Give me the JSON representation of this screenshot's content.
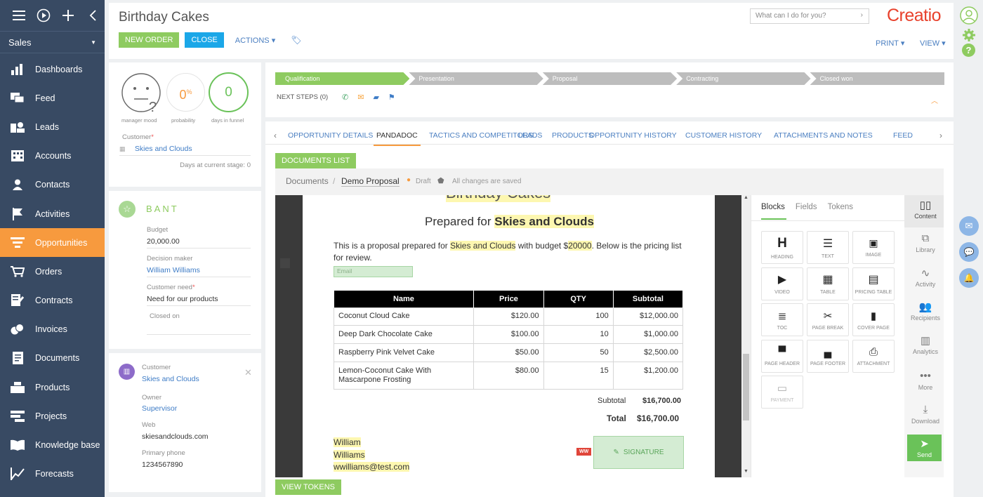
{
  "app": {
    "workspace": "Sales",
    "brand": "Creatio"
  },
  "sidebar": {
    "items": [
      {
        "label": "Dashboards",
        "icon": "bar-chart-icon"
      },
      {
        "label": "Feed",
        "icon": "chat-bubbles-icon"
      },
      {
        "label": "Leads",
        "icon": "leads-icon"
      },
      {
        "label": "Accounts",
        "icon": "building-icon"
      },
      {
        "label": "Contacts",
        "icon": "person-icon"
      },
      {
        "label": "Activities",
        "icon": "flag-icon"
      },
      {
        "label": "Opportunities",
        "icon": "funnel-icon"
      },
      {
        "label": "Orders",
        "icon": "cart-icon"
      },
      {
        "label": "Contracts",
        "icon": "contract-icon"
      },
      {
        "label": "Invoices",
        "icon": "invoice-icon"
      },
      {
        "label": "Documents",
        "icon": "document-icon"
      },
      {
        "label": "Products",
        "icon": "products-icon"
      },
      {
        "label": "Projects",
        "icon": "projects-icon"
      },
      {
        "label": "Knowledge base",
        "icon": "book-icon"
      },
      {
        "label": "Forecasts",
        "icon": "forecast-icon"
      }
    ]
  },
  "header": {
    "title": "Birthday Cakes",
    "new_order": "NEW ORDER",
    "close": "CLOSE",
    "actions": "ACTIONS",
    "print": "PRINT",
    "view": "VIEW",
    "search_placeholder": "What can I do for you?"
  },
  "summary": {
    "mood_label": "manager mood",
    "probability": "0",
    "probability_unit": "%",
    "probability_label": "probability",
    "days": "0",
    "days_label": "days in funnel",
    "customer_label": "Customer",
    "customer_value": "Skies and Clouds",
    "days_stage": "Days at current stage: 0"
  },
  "bant": {
    "title": "BANT",
    "budget_label": "Budget",
    "budget_value": "20,000.00",
    "decision_label": "Decision maker",
    "decision_value": "William Williams",
    "need_label": "Customer need",
    "need_value": "Need for our products",
    "closed_label": "Closed on"
  },
  "customer_card": {
    "customer_label": "Customer",
    "customer_value": "Skies and Clouds",
    "owner_label": "Owner",
    "owner_value": "Supervisor",
    "web_label": "Web",
    "web_value": "skiesandclouds.com",
    "phone_label": "Primary phone",
    "phone_value": "1234567890"
  },
  "stages": [
    "Qualification",
    "Presentation",
    "Proposal",
    "Contracting",
    "Closed won"
  ],
  "next_steps": "NEXT STEPS (0)",
  "tabs": [
    "OPPORTUNITY DETAILS",
    "PANDADOC",
    "TACTICS AND COMPETITORS",
    "LEADS",
    "PRODUCTS",
    "OPPORTUNITY HISTORY",
    "CUSTOMER HISTORY",
    "ATTACHMENTS AND NOTES",
    "FEED"
  ],
  "pandadoc": {
    "documents_list": "DOCUMENTS LIST",
    "breadcrumb_root": "Documents",
    "doc_name": "Demo Proposal",
    "status": "Draft",
    "saved": "All changes are saved",
    "view_tokens": "VIEW TOKENS"
  },
  "document": {
    "title_cut": "Birthday Cakes",
    "prepared_prefix": "Prepared for ",
    "prepared_name": "Skies and Clouds",
    "intro_1": "This is a proposal prepared for ",
    "intro_name": "Skies and Clouds",
    "intro_2": " with budget $",
    "intro_budget": "20000",
    "intro_3": ". Below is the pricing list",
    "intro_4": "for review.",
    "email_placeholder": "Email",
    "table": {
      "headers": [
        "Name",
        "Price",
        "QTY",
        "Subtotal"
      ],
      "rows": [
        [
          "Coconut Cloud Cake",
          "$120.00",
          "100",
          "$12,000.00"
        ],
        [
          "Deep Dark Chocolate Cake",
          "$100.00",
          "10",
          "$1,000.00"
        ],
        [
          "Raspberry Pink Velvet Cake",
          "$50.00",
          "50",
          "$2,500.00"
        ],
        [
          "Lemon-Coconut Cake With Mascarpone Frosting",
          "$80.00",
          "15",
          "$1,200.00"
        ]
      ]
    },
    "subtotal_label": "Subtotal",
    "subtotal_value": "$16,700.00",
    "total_label": "Total",
    "total_value": "$16,700.00",
    "sig_first": "William",
    "sig_last": "Williams",
    "sig_email": "wwilliams@test.com",
    "sig_tag": "WW",
    "signature": "SIGNATURE"
  },
  "editor": {
    "tabs": [
      "Blocks",
      "Fields",
      "Tokens"
    ],
    "blocks": [
      "HEADING",
      "TEXT",
      "IMAGE",
      "VIDEO",
      "TABLE",
      "PRICING TABLE",
      "TOC",
      "PAGE BREAK",
      "COVER PAGE",
      "PAGE HEADER",
      "PAGE FOOTER",
      "ATTACHMENT",
      "PAYMENT"
    ],
    "rail": [
      "Content",
      "Library",
      "Activity",
      "Recipients",
      "Analytics",
      "More",
      "Download",
      "Send"
    ]
  },
  "colors": {
    "sidebar": "#384a63",
    "accent": "#f79a3e",
    "green": "#8ecb60",
    "blue": "#1ba7e8",
    "link": "#4b7fc1",
    "brand": "#e8412c"
  }
}
